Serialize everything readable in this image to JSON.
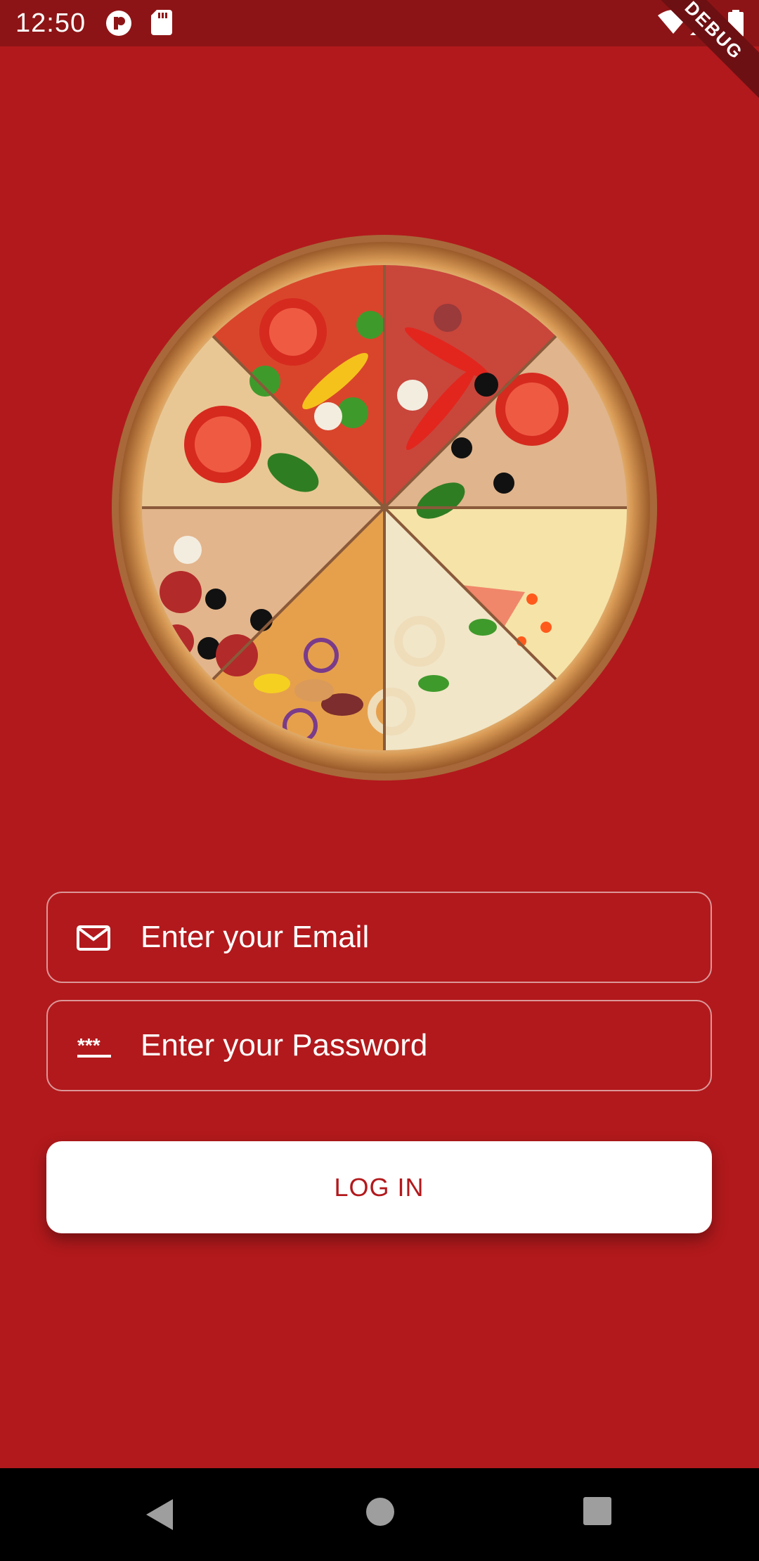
{
  "status_bar": {
    "time": "12:50",
    "debug_label": "DEBUG",
    "icons": [
      "app-notification-icon",
      "sd-card-icon",
      "wifi-icon",
      "signal-icon",
      "battery-icon"
    ]
  },
  "hero": {
    "image": "pizza-image"
  },
  "form": {
    "email_placeholder": "Enter your Email",
    "email_icon": "mail-icon",
    "password_placeholder": "Enter your Password",
    "password_icon": "password-icon",
    "login_label": "LOG IN"
  },
  "colors": {
    "background": "#b2191c",
    "status_bar": "#8d1416",
    "button": "#ffffff",
    "button_text": "#b2191c"
  },
  "nav_bar": {
    "buttons": [
      "back-icon",
      "home-icon",
      "recents-icon"
    ]
  }
}
